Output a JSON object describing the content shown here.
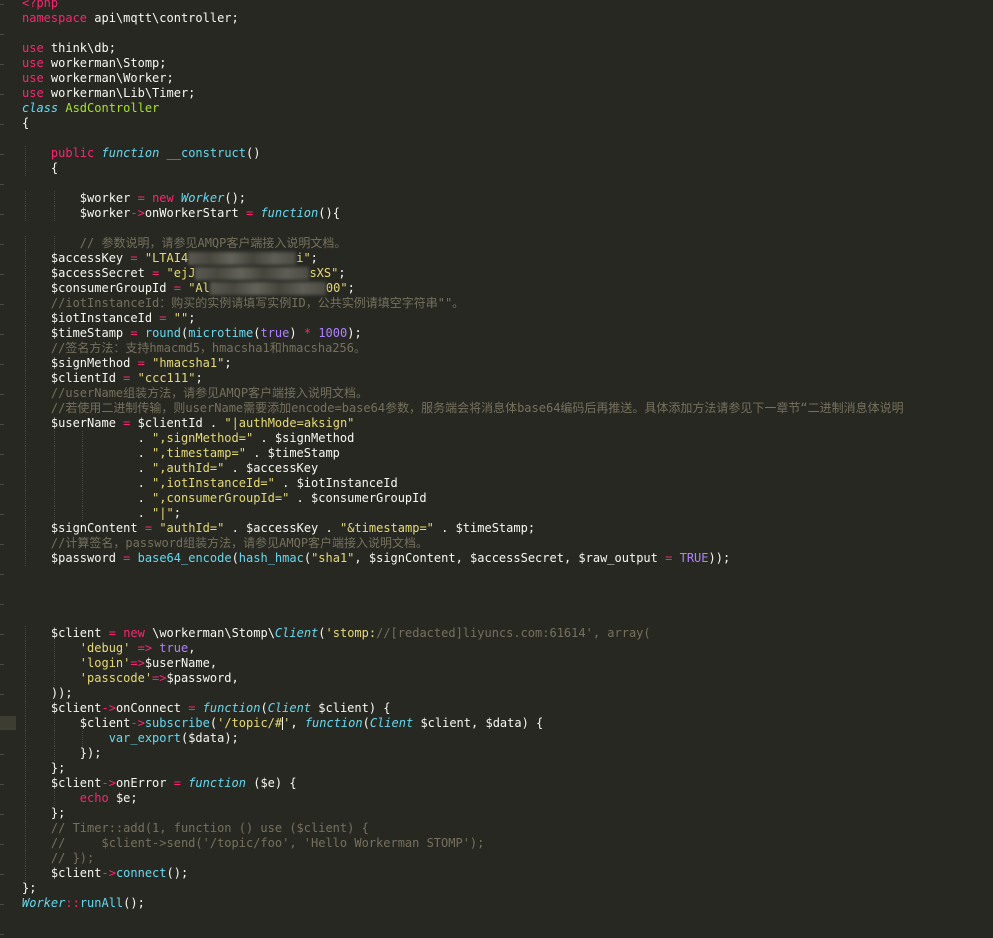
{
  "editor": {
    "theme_background": "#272822",
    "lines": [
      "<?php",
      "namespace api\\mqtt\\controller;",
      "",
      "use think\\db;",
      "use workerman\\Stomp;",
      "use workerman\\Worker;",
      "use workerman\\Lib\\Timer;",
      "class AsdController",
      "{",
      "",
      "    public function __construct()",
      "    {",
      "",
      "        $worker = new Worker();",
      "        $worker->onWorkerStart = function(){",
      "",
      "        // 参数说明，请参见AMQP客户端接入说明文档。",
      "    $accessKey = \"LTAI4[redacted]i\";",
      "    $accessSecret = \"ejJ[redacted]sXS\";",
      "    $consumerGroupId = \"Al[redacted]00\";",
      "    //iotInstanceId：购买的实例请填写实例ID，公共实例请填空字符串\"\"。",
      "    $iotInstanceId = \"\";",
      "    $timeStamp = round(microtime(true) * 1000);",
      "    //签名方法：支持hmacmd5，hmacsha1和hmacsha256。",
      "    $signMethod = \"hmacsha1\";",
      "    $clientId = \"ccc111\";",
      "    //userName组装方法，请参见AMQP客户端接入说明文档。",
      "    //若使用二进制传输，则userName需要添加encode=base64参数，服务端会将消息体base64编码后再推送。具体添加方法请参见下一章节“二进制消息体说明",
      "    $userName = $clientId . \"|authMode=aksign\"",
      "                . \",signMethod=\" . $signMethod",
      "                . \",timestamp=\" . $timeStamp",
      "                . \",authId=\" . $accessKey",
      "                . \",iotInstanceId=\" . $iotInstanceId",
      "                . \",consumerGroupId=\" . $consumerGroupId",
      "                . \"|\";",
      "    $signContent = \"authId=\" . $accessKey . \"&timestamp=\" . $timeStamp;",
      "    //计算签名，password组装方法，请参见AMQP客户端接入说明文档。",
      "    $password = base64_encode(hash_hmac(\"sha1\", $signContent, $accessSecret, $raw_output = TRUE));",
      "",
      "",
      "",
      "",
      "    $client = new \\workerman\\Stomp\\Client('stomp://[redacted]liyuncs.com:61614', array(",
      "        'debug' => true,",
      "        'login'=>$userName,",
      "        'passcode'=>$password,",
      "    ));",
      "    $client->onConnect = function(Client $client) {",
      "        $client->subscribe('/topic/#', function(Client $client, $data) {",
      "            var_export($data);",
      "        });",
      "    };",
      "    $client->onError = function ($e) {",
      "        echo $e;",
      "    };",
      "    // Timer::add(1, function () use ($client) {",
      "    //     $client->send('/topic/foo', 'Hello Workerman STOMP');",
      "    // });",
      "    $client->connect();",
      "};",
      "Worker::runAll();"
    ]
  }
}
